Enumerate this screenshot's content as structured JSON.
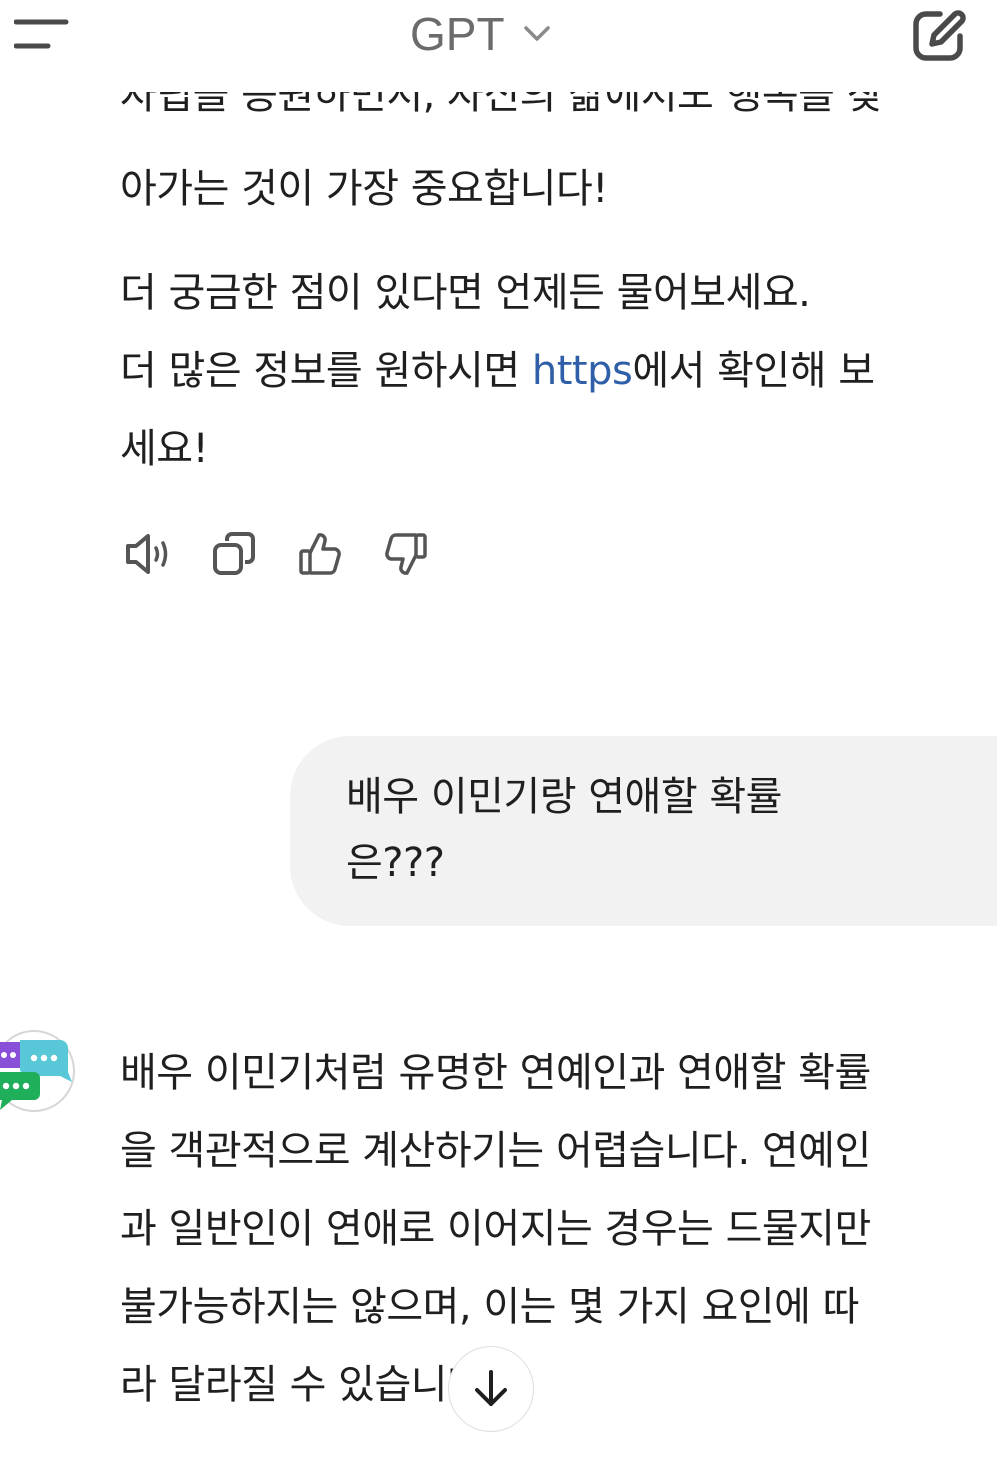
{
  "header": {
    "model_label": "GPT",
    "menu_icon": "menu-icon",
    "chevron_icon": "chevron-down-icon",
    "new_chat_icon": "new-chat-edit-icon"
  },
  "previous_reply": {
    "clipped_line": "자립을 응원하면서, 자신의 삶에서도 행복을 찾",
    "lines": [
      "아가는 것이 가장 중요합니다!"
    ],
    "followup_line": "더 궁금한 점이 있다면 언제든 물어보세요.",
    "info_prefix": "더 많은 정보를 원하시면 ",
    "info_link": "https",
    "info_suffix": "에서 확인해 보",
    "info_end": "세요!"
  },
  "actions": {
    "read_aloud": "speaker-icon",
    "copy": "copy-icon",
    "like": "thumbs-up-icon",
    "dislike": "thumbs-down-icon"
  },
  "user_message": {
    "lines": [
      "배우 이민기랑 연애할 확률",
      "은???"
    ]
  },
  "reply": {
    "avatar": "chat-bubbles-avatar-icon",
    "lines": [
      "배우 이민기처럼 유명한 연예인과 연애할 확률",
      "을 객관적으로 계산하기는 어렵습니다. 연예인",
      "과 일반인이 연애로 이어지는 경우는 드물지만",
      "불가능하지는 않으며, 이는 몇 가지 요인에 따",
      "라 달라질 수 있습니다."
    ]
  },
  "scroll_down": "arrow-down-icon",
  "colors": {
    "link": "#2f5fa8",
    "bubble": "#f2f2f2",
    "icon": "#5a5a5a",
    "avatar_purple": "#8a4fd8",
    "avatar_teal": "#58c8d8",
    "avatar_green": "#1fae5a"
  }
}
